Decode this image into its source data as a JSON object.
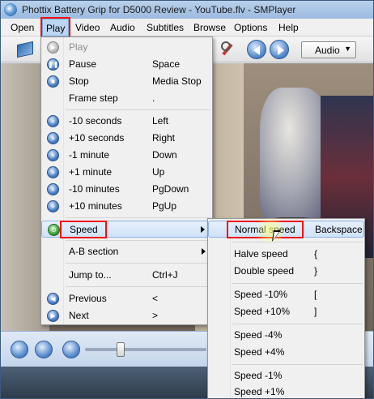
{
  "window": {
    "title": "Phottix Battery Grip for D5000 Review - YouTube.flv - SMPlayer"
  },
  "menubar": {
    "items": [
      {
        "label": "Open"
      },
      {
        "label": "Play"
      },
      {
        "label": "Video"
      },
      {
        "label": "Audio"
      },
      {
        "label": "Subtitles"
      },
      {
        "label": "Browse"
      },
      {
        "label": "Options"
      },
      {
        "label": "Help"
      }
    ]
  },
  "toolbar": {
    "audio_select": "Audio"
  },
  "play_menu": {
    "items": [
      {
        "label": "Play",
        "accel": ""
      },
      {
        "label": "Pause",
        "accel": "Space"
      },
      {
        "label": "Stop",
        "accel": "Media Stop"
      },
      {
        "label": "Frame step",
        "accel": "."
      },
      {
        "label": "-10 seconds",
        "accel": "Left"
      },
      {
        "label": "+10 seconds",
        "accel": "Right"
      },
      {
        "label": "-1 minute",
        "accel": "Down"
      },
      {
        "label": "+1 minute",
        "accel": "Up"
      },
      {
        "label": "-10 minutes",
        "accel": "PgDown"
      },
      {
        "label": "+10 minutes",
        "accel": "PgUp"
      },
      {
        "label": "Speed",
        "accel": ""
      },
      {
        "label": "A-B section",
        "accel": ""
      },
      {
        "label": "Jump to...",
        "accel": "Ctrl+J"
      },
      {
        "label": "Previous",
        "accel": "<"
      },
      {
        "label": "Next",
        "accel": ">"
      }
    ]
  },
  "speed_menu": {
    "items": [
      {
        "label": "Normal speed",
        "accel": "Backspace"
      },
      {
        "label": "Halve speed",
        "accel": "{"
      },
      {
        "label": "Double speed",
        "accel": "}"
      },
      {
        "label": "Speed -10%",
        "accel": "["
      },
      {
        "label": "Speed +10%",
        "accel": "]"
      },
      {
        "label": "Speed -4%",
        "accel": ""
      },
      {
        "label": "Speed +4%",
        "accel": ""
      },
      {
        "label": "Speed -1%",
        "accel": ""
      },
      {
        "label": "Speed +1%",
        "accel": ""
      }
    ]
  },
  "colors": {
    "highlight_outline": "#e11111",
    "menu_hover": "#cfe2f7"
  },
  "icons": {
    "play": "play-icon",
    "pause": "pause-icon",
    "stop": "stop-icon",
    "rewind": "rewind-icon",
    "forward": "forward-icon",
    "speed": "speed-icon",
    "previous": "previous-icon",
    "next": "next-icon"
  }
}
